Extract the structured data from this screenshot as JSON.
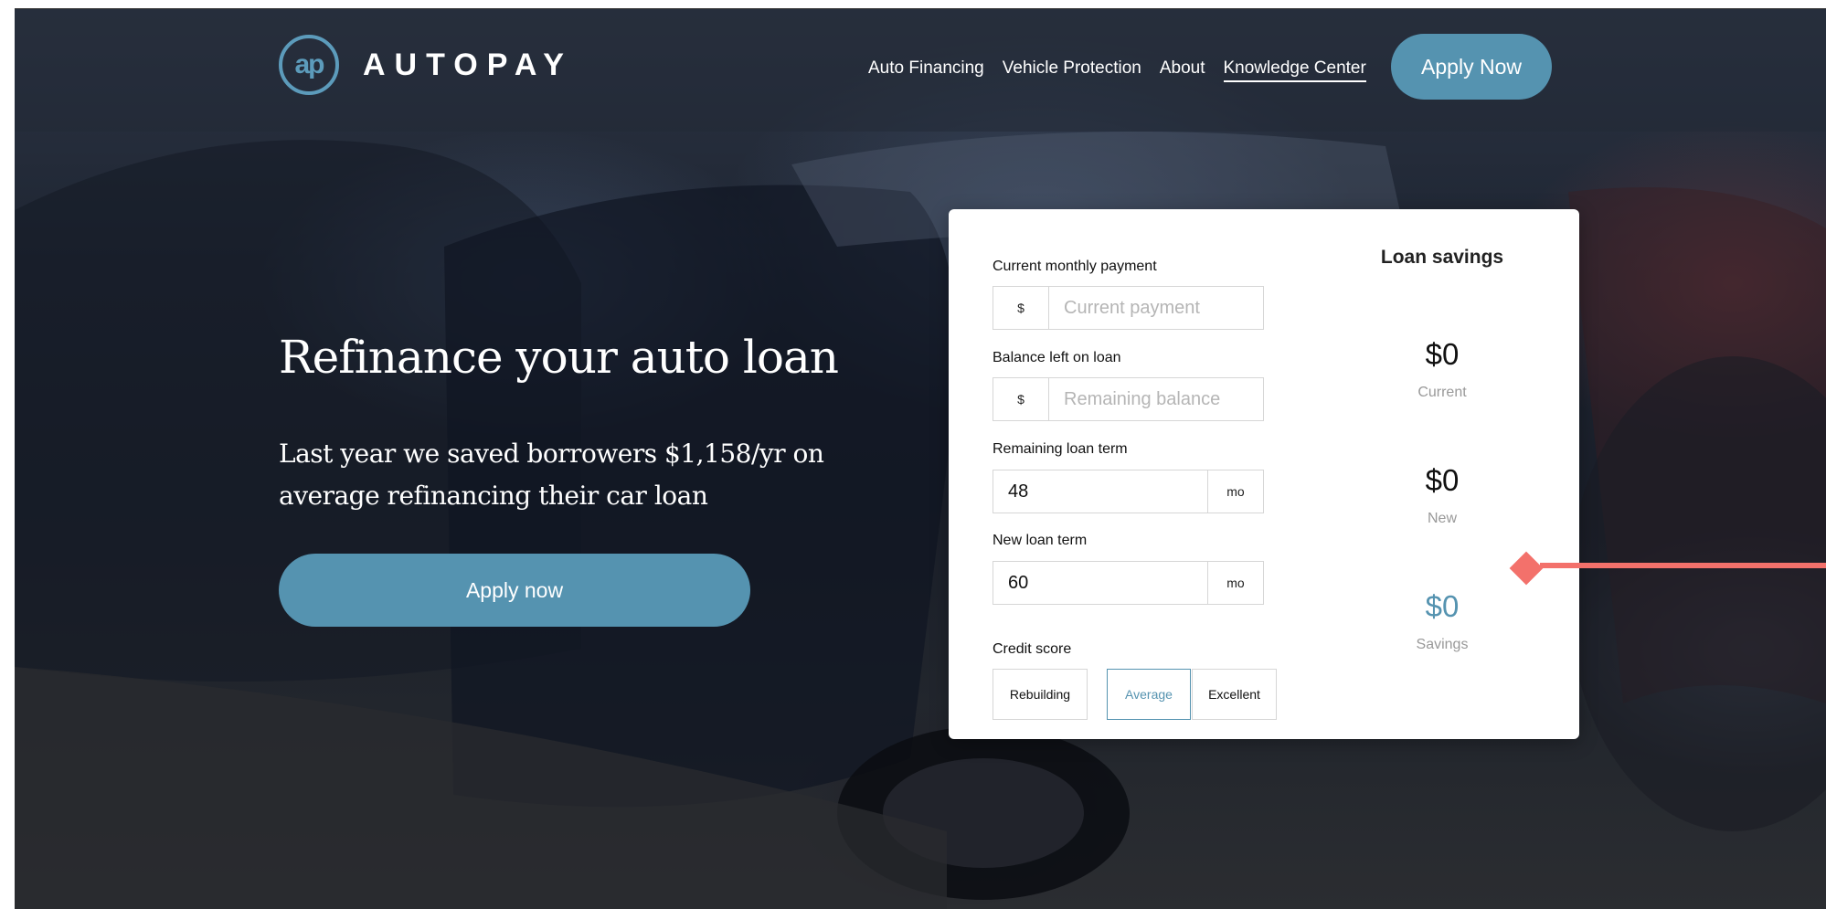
{
  "brand": {
    "logo_mark": "ap",
    "name": "AUTOPAY"
  },
  "nav": {
    "links": [
      "Auto Financing",
      "Vehicle Protection",
      "About",
      "Knowledge Center"
    ],
    "active": "Knowledge Center",
    "apply_label": "Apply Now"
  },
  "hero": {
    "title": "Refinance your auto loan",
    "subtitle": "Last year we saved borrowers $1,158/yr on average refinancing their car loan",
    "cta_label": "Apply now"
  },
  "calculator": {
    "current_payment": {
      "label": "Current monthly payment",
      "prefix": "$",
      "placeholder": "Current payment",
      "value": ""
    },
    "balance": {
      "label": "Balance left on loan",
      "prefix": "$",
      "placeholder": "Remaining balance",
      "value": ""
    },
    "remaining_term": {
      "label": "Remaining loan term",
      "value": "48",
      "suffix": "mo"
    },
    "new_term": {
      "label": "New loan term",
      "value": "60",
      "suffix": "mo"
    },
    "credit_score": {
      "label": "Credit score",
      "options": [
        "Rebuilding",
        "Average",
        "Excellent"
      ],
      "selected": "Average"
    }
  },
  "savings": {
    "title": "Loan savings",
    "current": {
      "value": "$0",
      "caption": "Current"
    },
    "new": {
      "value": "$0",
      "caption": "New"
    },
    "savings": {
      "value": "$0",
      "caption": "Savings"
    }
  },
  "colors": {
    "accent": "#5593b0",
    "pointer": "#f3716b",
    "logo": "#5c9bbb"
  },
  "icons": {
    "pointer": "pointer-diamond-icon"
  }
}
